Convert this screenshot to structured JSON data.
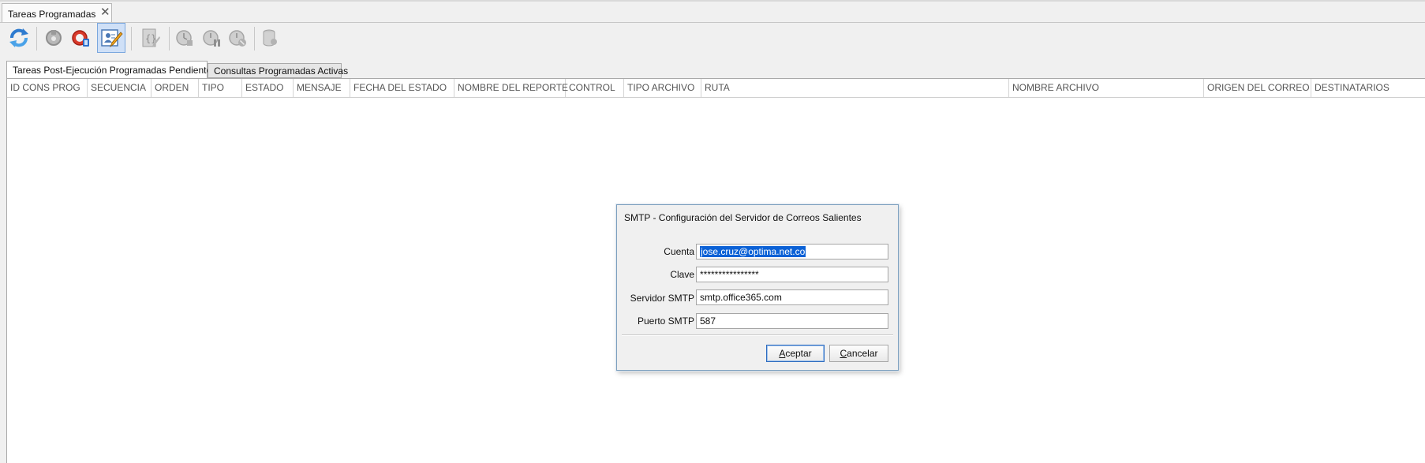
{
  "document_tab": {
    "title": "Tareas Programadas",
    "close_glyph": "✕"
  },
  "toolbar": {
    "buttons": [
      {
        "icon": "refresh-icon",
        "state": "enabled"
      },
      {
        "icon": "execute-task-icon",
        "state": "disabled"
      },
      {
        "icon": "stop-task-icon",
        "state": "enabled"
      },
      {
        "icon": "edit-smtp-config-icon",
        "state": "active"
      },
      {
        "icon": "script-edit-icon",
        "state": "disabled"
      },
      {
        "icon": "schedule-clock-icon",
        "state": "disabled"
      },
      {
        "icon": "schedule-pause-icon",
        "state": "disabled"
      },
      {
        "icon": "schedule-cancel-icon",
        "state": "disabled"
      },
      {
        "icon": "database-icon",
        "state": "disabled"
      }
    ]
  },
  "subtabs": [
    {
      "label": "Tareas Post-Ejecución Programadas Pendientes",
      "active": true
    },
    {
      "label": "Consultas Programadas Activas",
      "active": false
    }
  ],
  "table": {
    "columns": [
      "ID CONS PROG",
      "SECUENCIA",
      "ORDEN",
      "TIPO",
      "ESTADO",
      "MENSAJE",
      "FECHA DEL ESTADO",
      "NOMBRE DEL REPORTE",
      "CONTROL",
      "TIPO ARCHIVO",
      "RUTA",
      "NOMBRE ARCHIVO",
      "ORIGEN DEL CORREO",
      "DESTINATARIOS"
    ],
    "rows": []
  },
  "dialog": {
    "title": "SMTP - Configuración del  Servidor de Correos Salientes",
    "fields": {
      "account": {
        "label": "Cuenta",
        "value": "jose.cruz@optima.net.co"
      },
      "password": {
        "label": "Clave",
        "value": "****************"
      },
      "server": {
        "label": "Servidor SMTP",
        "value": "smtp.office365.com"
      },
      "port": {
        "label": "Puerto SMTP",
        "value": "587"
      }
    },
    "buttons": {
      "accept_first": "A",
      "accept_rest": "ceptar",
      "cancel_first": "C",
      "cancel_rest": "ancelar"
    }
  }
}
